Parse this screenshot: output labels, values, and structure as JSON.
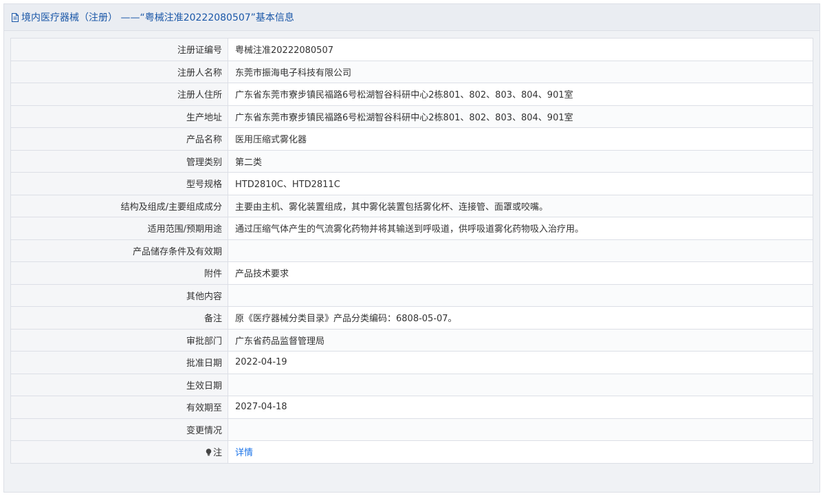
{
  "header": {
    "icon": "document-icon",
    "title": "境内医疗器械（注册） ——“粤械注准20222080507”基本信息"
  },
  "rows": [
    {
      "label": "注册证编号",
      "value": "粤械注准20222080507"
    },
    {
      "label": "注册人名称",
      "value": "东莞市振海电子科技有限公司"
    },
    {
      "label": "注册人住所",
      "value": "广东省东莞市寮步镇民福路6号松湖智谷科研中心2栋801、802、803、804、901室"
    },
    {
      "label": "生产地址",
      "value": "广东省东莞市寮步镇民福路6号松湖智谷科研中心2栋801、802、803、804、901室"
    },
    {
      "label": "产品名称",
      "value": "医用压缩式雾化器"
    },
    {
      "label": "管理类别",
      "value": "第二类"
    },
    {
      "label": "型号规格",
      "value": "HTD2810C、HTD2811C"
    },
    {
      "label": "结构及组成/主要组成成分",
      "value": "主要由主机、雾化装置组成，其中雾化装置包括雾化杯、连接管、面罩或咬嘴。"
    },
    {
      "label": "适用范围/预期用途",
      "value": "通过压缩气体产生的气流雾化药物并将其输送到呼吸道，供呼吸道雾化药物吸入治疗用。"
    },
    {
      "label": "产品储存条件及有效期",
      "value": ""
    },
    {
      "label": "附件",
      "value": "产品技术要求"
    },
    {
      "label": "其他内容",
      "value": ""
    },
    {
      "label": "备注",
      "value": "原《医疗器械分类目录》产品分类编码：6808-05-07。"
    },
    {
      "label": "审批部门",
      "value": "广东省药品监督管理局"
    },
    {
      "label": "批准日期",
      "value": "2022-04-19"
    },
    {
      "label": "生效日期",
      "value": ""
    },
    {
      "label": "有效期至",
      "value": "2027-04-18"
    },
    {
      "label": "变更情况",
      "value": ""
    }
  ],
  "note": {
    "icon": "lightbulb-icon",
    "label": "注",
    "link": "详情"
  },
  "colors": {
    "header_text": "#1a57a8",
    "link": "#1a73e8",
    "border": "#dcdfe6"
  }
}
